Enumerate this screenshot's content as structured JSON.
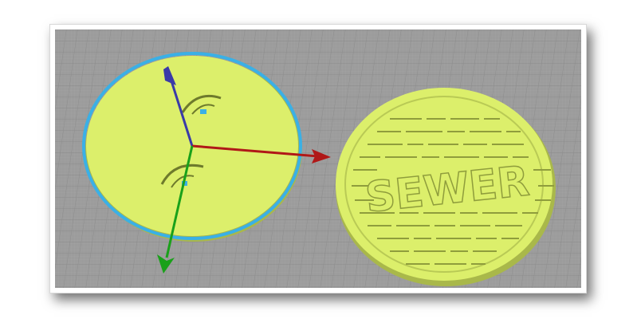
{
  "viewport": {
    "background_color": "#9c9c9c",
    "grid_color": "#8d8d8d",
    "part_color": "#dcef6b",
    "part_shadow_color": "#a9b84a",
    "selection_outline_color": "#3ab0e6",
    "embossed_text": "SEWER"
  },
  "gizmo": {
    "x_axis_color": "#b01818",
    "y_axis_color": "#1aa11a",
    "z_axis_color": "#3a3aa8"
  },
  "icons": {
    "x_arrow": "x-axis-arrow-icon",
    "y_arrow": "y-axis-arrow-icon",
    "z_arrow": "z-axis-arrow-icon"
  }
}
